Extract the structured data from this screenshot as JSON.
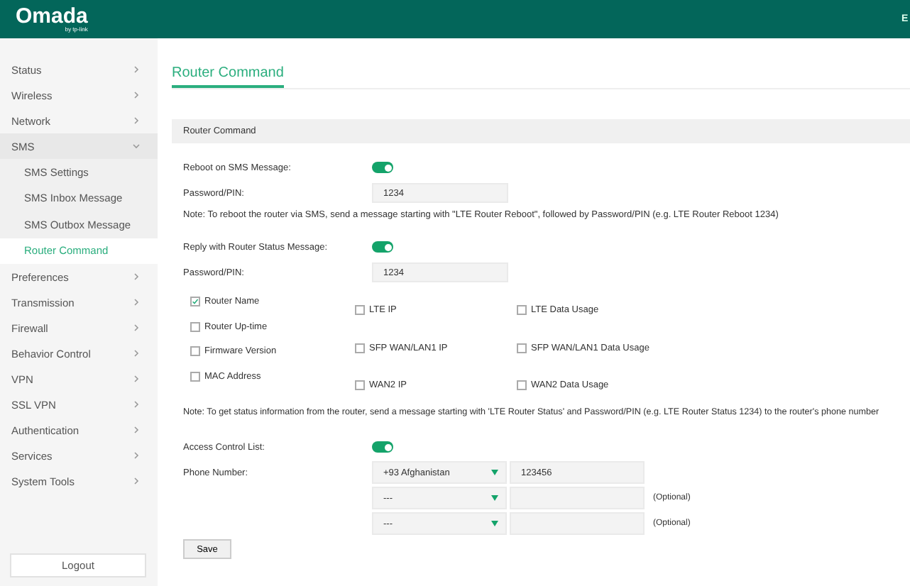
{
  "header": {
    "logo": "Omada",
    "logo_sub": "by tp-link",
    "corner_text": "E"
  },
  "sidebar": {
    "items": [
      {
        "label": "Status",
        "expanded": false,
        "selected": false
      },
      {
        "label": "Wireless",
        "expanded": false,
        "selected": false
      },
      {
        "label": "Network",
        "expanded": false,
        "selected": false
      },
      {
        "label": "SMS",
        "expanded": true,
        "selected": false,
        "children": [
          {
            "label": "SMS Settings",
            "selected": false
          },
          {
            "label": "SMS Inbox Message",
            "selected": false
          },
          {
            "label": "SMS Outbox Message",
            "selected": false
          },
          {
            "label": "Router Command",
            "selected": true
          }
        ]
      },
      {
        "label": "Preferences",
        "expanded": false,
        "selected": false
      },
      {
        "label": "Transmission",
        "expanded": false,
        "selected": false
      },
      {
        "label": "Firewall",
        "expanded": false,
        "selected": false
      },
      {
        "label": "Behavior Control",
        "expanded": false,
        "selected": false
      },
      {
        "label": "VPN",
        "expanded": false,
        "selected": false
      },
      {
        "label": "SSL VPN",
        "expanded": false,
        "selected": false
      },
      {
        "label": "Authentication",
        "expanded": false,
        "selected": false
      },
      {
        "label": "Services",
        "expanded": false,
        "selected": false
      },
      {
        "label": "System Tools",
        "expanded": false,
        "selected": false
      }
    ],
    "logout": "Logout"
  },
  "page_title": "Router Command",
  "panel_title": "Router Command",
  "reboot": {
    "label": "Reboot on SMS Message:",
    "on": true,
    "pin_label": "Password/PIN:",
    "pin": "1234",
    "note": "Note: To reboot the router via SMS, send a message starting with \"LTE Router Reboot\", followed by Password/PIN (e.g. LTE Router Reboot 1234)"
  },
  "status": {
    "label": "Reply with Router Status Message:",
    "on": true,
    "pin_label": "Password/PIN:",
    "pin": "1234",
    "checkbox_columns": [
      [
        {
          "label": "Router Name",
          "checked": true
        },
        {
          "label": "Router Up-time",
          "checked": false
        },
        {
          "label": "Firmware Version",
          "checked": false
        },
        {
          "label": "MAC Address",
          "checked": false
        }
      ],
      [
        {
          "label": "LTE IP",
          "checked": false
        },
        {
          "label": "SFP WAN/LAN1 IP",
          "checked": false
        },
        {
          "label": "WAN2 IP",
          "checked": false
        }
      ],
      [
        {
          "label": "LTE Data Usage",
          "checked": false
        },
        {
          "label": "SFP WAN/LAN1 Data Usage",
          "checked": false
        },
        {
          "label": "WAN2 Data Usage",
          "checked": false
        }
      ]
    ],
    "note": "Note: To get status information from the router, send a message starting with 'LTE Router Status' and Password/PIN (e.g. LTE Router Status 1234) to the router's phone number"
  },
  "acl": {
    "label": "Access Control List:",
    "on": true,
    "phone_label": "Phone Number:",
    "phones": [
      {
        "country": "+93 Afghanistan",
        "number": "123456"
      },
      {
        "country": "---",
        "hint": "(Optional)"
      },
      {
        "country": "---",
        "hint": "(Optional)"
      }
    ]
  },
  "save": "Save"
}
